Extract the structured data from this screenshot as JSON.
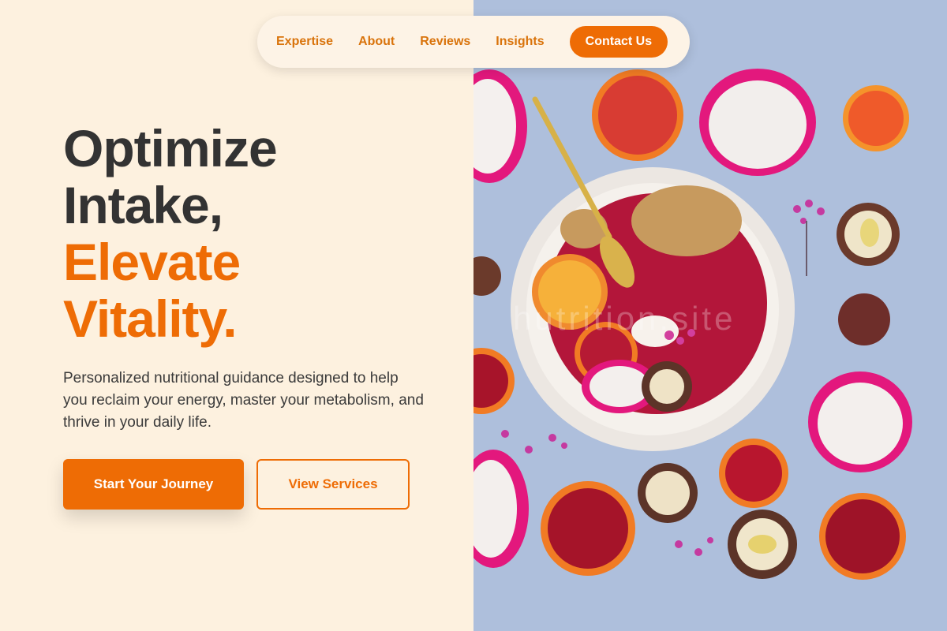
{
  "nav": {
    "links": [
      "Expertise",
      "About",
      "Reviews",
      "Insights"
    ],
    "cta": "Contact Us"
  },
  "hero": {
    "headline_dark_1": "Optimize",
    "headline_dark_2": "Intake,",
    "headline_orange_1": "Elevate",
    "headline_orange_2": "Vitality.",
    "subtext": "Personalized nutritional guidance designed to help you reclaim your energy, master your metabolism, and thrive in your daily life.",
    "primary_button": "Start Your Journey",
    "secondary_button": "View Services"
  },
  "image": {
    "description": "smoothie bowl with dragon fruit, blood oranges and rambutan",
    "watermark": "hutrition.site"
  },
  "colors": {
    "accent": "#ee6c05",
    "background": "#fdf1df",
    "text_dark": "#333333"
  }
}
